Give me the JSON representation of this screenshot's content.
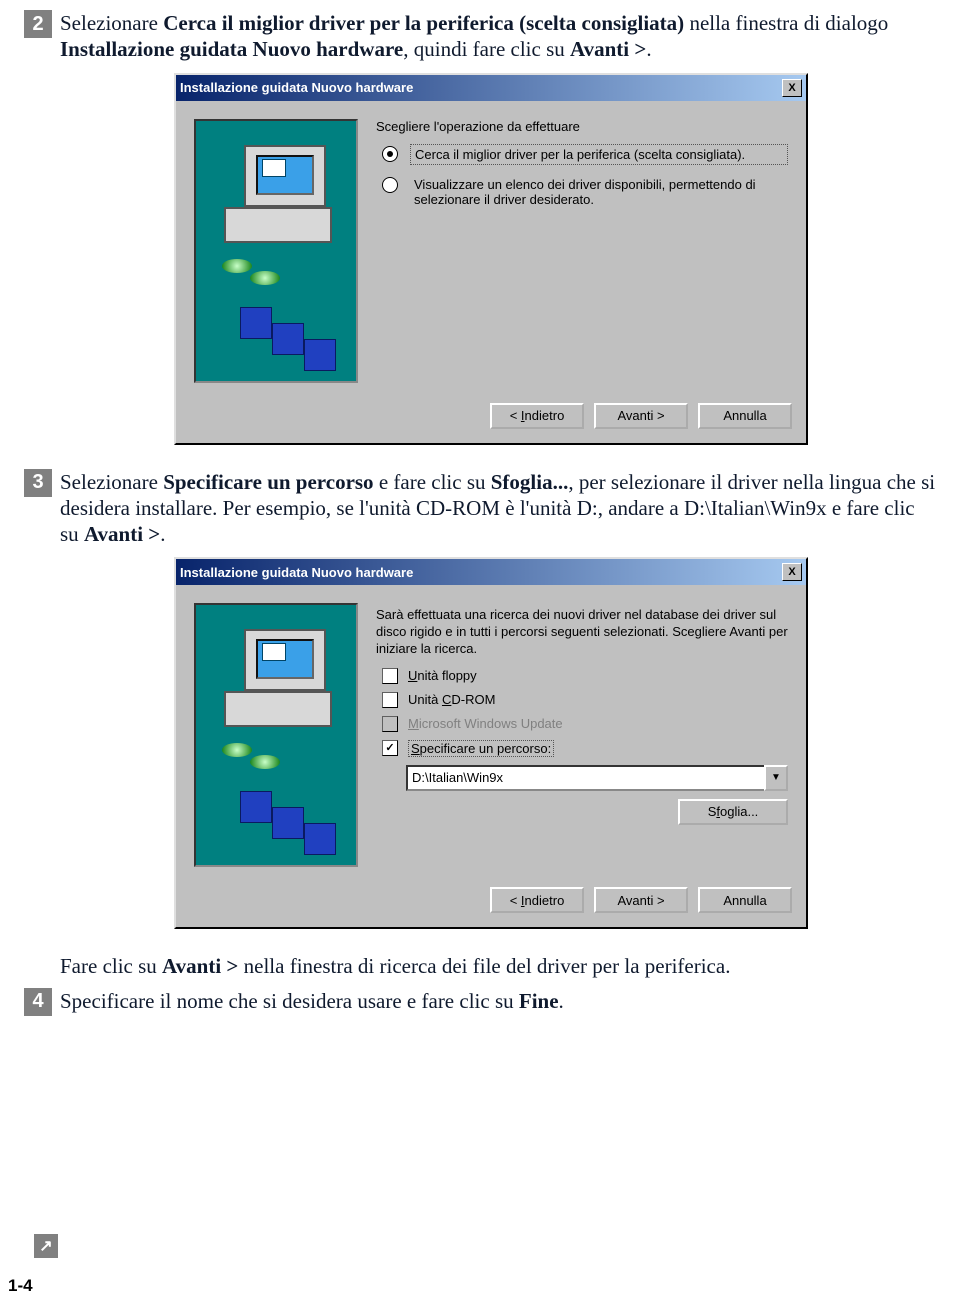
{
  "steps": {
    "s2": {
      "num": "2",
      "parts": [
        "Selezionare ",
        "Cerca il miglior driver per la periferica (scelta consigliata)",
        " nella finestra di dialogo ",
        "Installazione guidata Nuovo hardware",
        ", quindi fare clic su ",
        "Avanti >",
        "."
      ]
    },
    "s3": {
      "num": "3",
      "parts": [
        "Selezionare ",
        "Specificare un percorso",
        " e fare clic su ",
        "Sfoglia...",
        ", per selezionare il driver nella lingua che si desidera installare. Per esempio, se l'unità CD-ROM è l'unità D:, andare a D:\\Italian\\Win9x e fare clic su ",
        "Avanti >",
        "."
      ]
    },
    "s3b": {
      "parts": [
        "Fare clic su ",
        "Avanti >",
        " nella finestra di ricerca dei file del driver per la periferica."
      ]
    },
    "s4": {
      "num": "4",
      "parts": [
        "Specificare il nome che si desidera usare e fare clic su ",
        "Fine",
        "."
      ]
    }
  },
  "dlg1": {
    "title": "Installazione guidata Nuovo hardware",
    "prompt": "Scegliere l'operazione da effettuare",
    "opt1": "Cerca il miglior driver per la periferica (scelta consigliata).",
    "opt2": "Visualizzare un elenco dei driver disponibili, permettendo di selezionare il driver desiderato.",
    "back": "< Indietro",
    "next": "Avanti >",
    "cancel": "Annulla",
    "close": "X"
  },
  "dlg2": {
    "title": "Installazione guidata Nuovo hardware",
    "para": "Sarà effettuata una ricerca dei nuovi driver nel database dei driver sul disco rigido e in tutti i percorsi seguenti selezionati. Scegliere Avanti per iniziare la ricerca.",
    "c1": "Unità floppy",
    "c2": "Unità CD-ROM",
    "c3": "Microsoft Windows Update",
    "c4": "Specificare un percorso:",
    "path": "D:\\Italian\\Win9x",
    "browse": "Sfoglia...",
    "back": "< Indietro",
    "next": "Avanti >",
    "cancel": "Annulla",
    "close": "X",
    "dd": "▼"
  },
  "pagenum": "1-4",
  "arrow": "↗"
}
